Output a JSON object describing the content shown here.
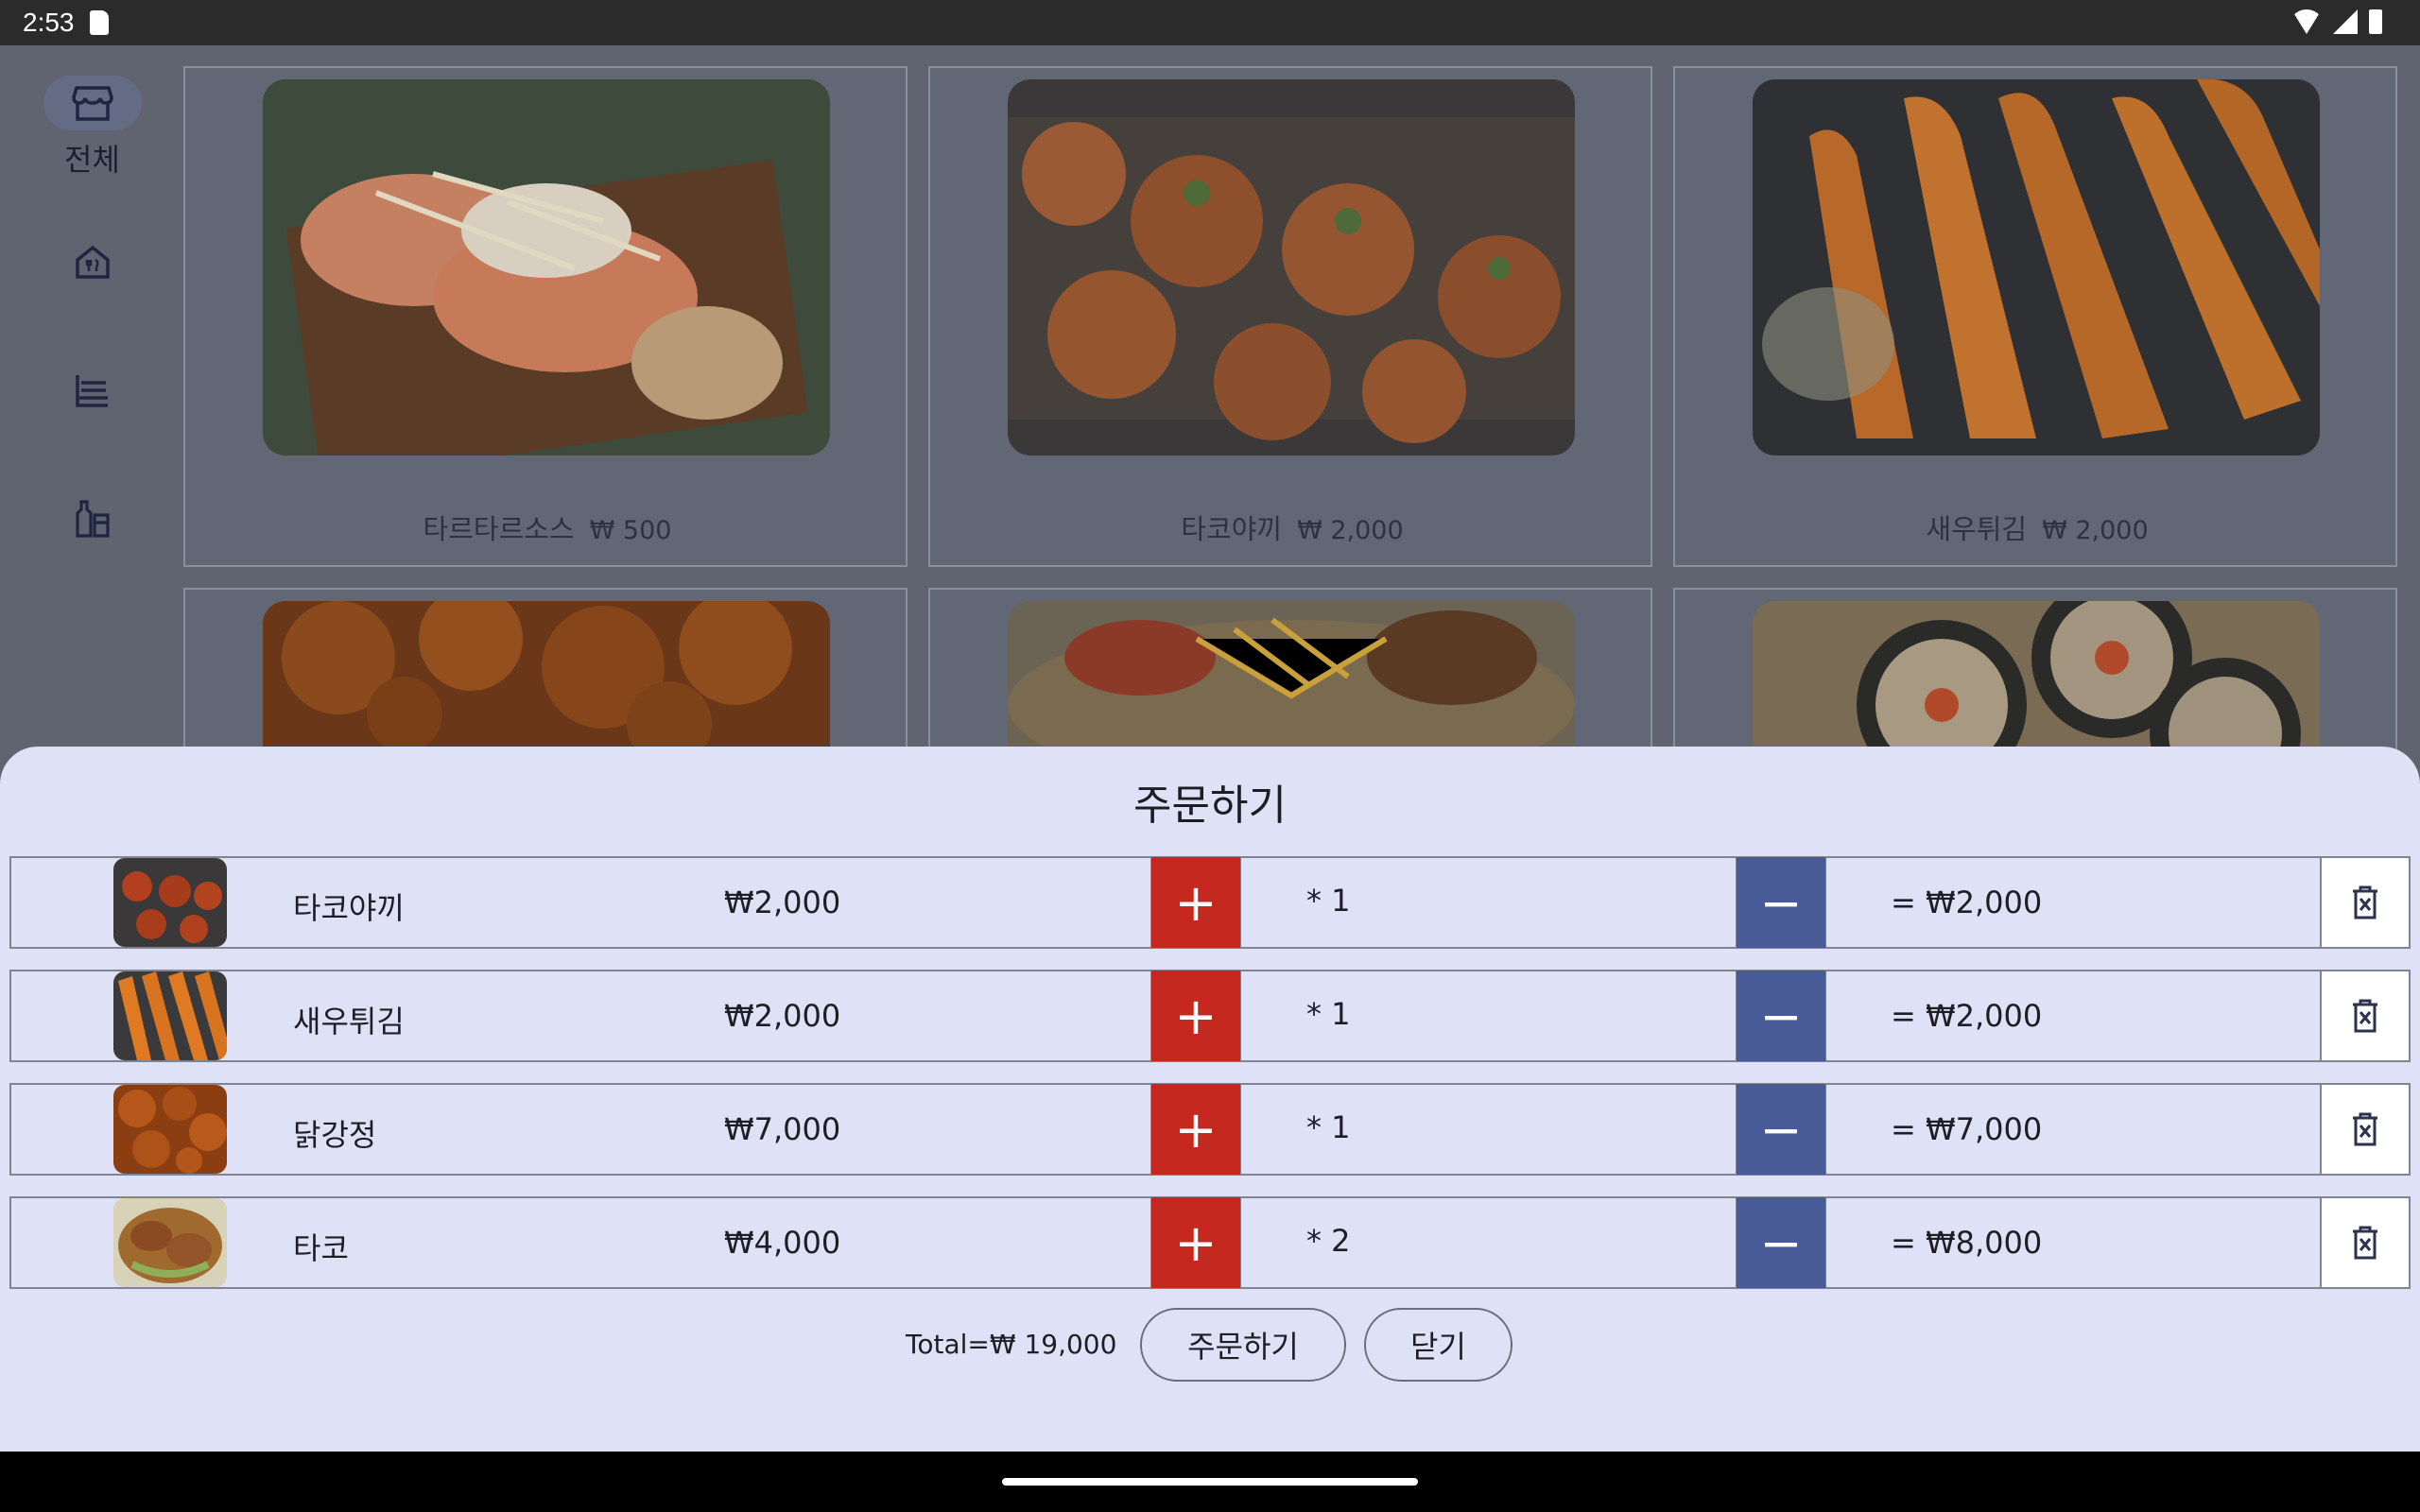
{
  "status_bar": {
    "time": "2:53"
  },
  "rail": {
    "items": [
      {
        "label": "전체",
        "icon": "store-icon",
        "active": true
      },
      {
        "label": "",
        "icon": "restaurant-icon",
        "active": false
      },
      {
        "label": "",
        "icon": "noodle-bowl-icon",
        "active": false
      },
      {
        "label": "",
        "icon": "liquor-icon",
        "active": false
      }
    ]
  },
  "menu_grid": {
    "cards": [
      {
        "name": "타르타르소스",
        "price": "₩ 500"
      },
      {
        "name": "타코야끼",
        "price": "₩ 2,000"
      },
      {
        "name": "새우튀김",
        "price": "₩ 2,000"
      },
      {
        "name": "",
        "price": ""
      },
      {
        "name": "",
        "price": ""
      },
      {
        "name": "",
        "price": ""
      }
    ]
  },
  "order_sheet": {
    "title": "주문하기",
    "rows": [
      {
        "name": "타코야끼",
        "unit_price": "₩2,000",
        "qty": "* 1",
        "subtotal": "= ₩2,000"
      },
      {
        "name": "새우튀김",
        "unit_price": "₩2,000",
        "qty": "* 1",
        "subtotal": "= ₩2,000"
      },
      {
        "name": "닭강정",
        "unit_price": "₩7,000",
        "qty": "* 1",
        "subtotal": "= ₩7,000"
      },
      {
        "name": "타코",
        "unit_price": "₩4,000",
        "qty": "* 2",
        "subtotal": "= ₩8,000"
      }
    ],
    "plus_symbol": "+",
    "minus_symbol": "−",
    "total_label": "Total=",
    "total_value": "₩ 19,000",
    "order_button": "주문하기",
    "close_button": "닫기"
  },
  "colors": {
    "plus_button": "#c5281f",
    "minus_button": "#495b96",
    "sheet_background": "#dfe2f6"
  }
}
